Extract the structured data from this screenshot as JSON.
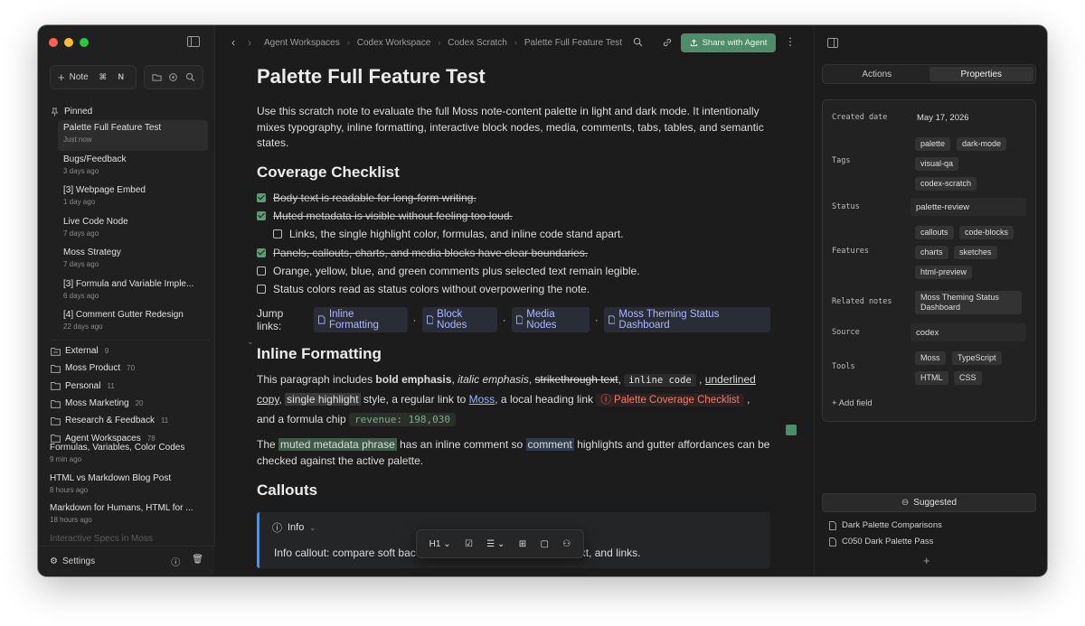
{
  "sidebar": {
    "new_note_label": "Note",
    "new_note_shortcut": "⌘ N",
    "pinned_header": "Pinned",
    "pinned": [
      {
        "title": "Palette Full Feature Test",
        "time": "Just now"
      },
      {
        "title": "Bugs/Feedback",
        "time": "3 days ago"
      },
      {
        "title": "[3] Webpage Embed",
        "time": "1 day ago"
      },
      {
        "title": "Live Code Node",
        "time": "7 days ago"
      },
      {
        "title": "Moss Strategy",
        "time": "7 days ago"
      },
      {
        "title": "[3] Formula and Variable Imple...",
        "time": "6 days ago"
      },
      {
        "title": "[4] Comment Gutter Redesign",
        "time": "22 days ago"
      }
    ],
    "folders": [
      {
        "name": "External",
        "count": "9"
      },
      {
        "name": "Moss Product",
        "count": "70"
      },
      {
        "name": "Personal",
        "count": "11"
      },
      {
        "name": "Moss Marketing",
        "count": "20"
      },
      {
        "name": "Research & Feedback",
        "count": "11"
      },
      {
        "name": "Agent Workspaces",
        "count": "78"
      }
    ],
    "recent": [
      {
        "title": "Formulas, Variables, Color Codes",
        "time": "9 min ago"
      },
      {
        "title": "HTML vs Markdown Blog Post",
        "time": "8 hours ago"
      },
      {
        "title": "Markdown for Humans, HTML for ...",
        "time": "18 hours ago"
      },
      {
        "title": "Interactive Specs in Moss",
        "time": ""
      }
    ],
    "settings_label": "Settings"
  },
  "topbar": {
    "breadcrumbs": [
      "Agent Workspaces",
      "Codex Workspace",
      "Codex Scratch",
      "Palette Full Feature Test"
    ],
    "share_label": "Share with Agent"
  },
  "doc": {
    "title": "Palette Full Feature Test",
    "intro": "Use this scratch note to evaluate the full Moss note-content palette in light and dark mode. It intentionally mixes typography, inline formatting, interactive block nodes, media, comments, tabs, tables, and semantic states.",
    "checklist_heading": "Coverage Checklist",
    "checklist": [
      {
        "text": "Body text is readable for long-form writing.",
        "done": true,
        "indent": false
      },
      {
        "text": "Muted metadata is visible without feeling too loud.",
        "done": true,
        "indent": false
      },
      {
        "text": "Links, the single highlight color, formulas, and inline code stand apart.",
        "done": false,
        "indent": true
      },
      {
        "text": "Panels, callouts, charts, and media blocks have clear boundaries.",
        "done": true,
        "indent": false
      },
      {
        "text": "Orange, yellow, blue, and green comments plus selected text remain legible.",
        "done": false,
        "indent": false
      },
      {
        "text": "Status colors read as status colors without overpowering the note.",
        "done": false,
        "indent": false
      }
    ],
    "jump_label": "Jump links:",
    "jump_links": [
      "Inline Formatting",
      "Block Nodes",
      "Media Nodes",
      "Moss Theming Status Dashboard"
    ],
    "inline_heading": "Inline Formatting",
    "inline": {
      "p1_a": "This paragraph includes ",
      "bold": "bold emphasis",
      "sep1": ", ",
      "italic": "italic emphasis",
      "sep2": ", ",
      "strike": "strikethrough text",
      "sep3": ", ",
      "code": "inline code",
      "sep4": " , ",
      "underline": "underlined copy",
      "sep5": ", ",
      "highlight": "single highlight",
      "p1_b": " style, a regular link to ",
      "link": "Moss",
      "p1_c": ", a local heading link ",
      "heading_link": "Palette Coverage Checklist",
      "p1_d": " , and a formula chip ",
      "formula": "revenue:  198,030",
      "p2_a": "The ",
      "muted_phrase": "muted metadata phrase",
      "p2_b": " has an inline comment so ",
      "comment": "comment",
      "p2_c": " highlights and gutter affordances can be checked against the active palette."
    },
    "callouts_heading": "Callouts",
    "callout_title": "Info",
    "callout_body_a": "Info callout: compare soft bac",
    "callout_body_b": "text, and links."
  },
  "format_toolbar": {
    "heading": "H1"
  },
  "panel": {
    "tabs": [
      "Actions",
      "Properties"
    ],
    "active_tab": "Properties",
    "properties": {
      "created_label": "Created date",
      "created_value": "May 17, 2026",
      "tags_label": "Tags",
      "tags": [
        "palette",
        "dark-mode",
        "visual-qa",
        "codex-scratch"
      ],
      "status_label": "Status",
      "status_value": "palette-review",
      "features_label": "Features",
      "features": [
        "callouts",
        "code-blocks",
        "charts",
        "sketches",
        "html-preview"
      ],
      "related_label": "Related notes",
      "related_value": "Moss Theming Status Dashboard",
      "source_label": "Source",
      "source_value": "codex",
      "tools_label": "Tools",
      "tools": [
        "Moss",
        "TypeScript",
        "HTML",
        "CSS"
      ],
      "add_field": "+ Add field"
    },
    "suggested_label": "Suggested",
    "suggested": [
      "Dark Palette Comparisons",
      "C050 Dark Palette Pass"
    ]
  }
}
